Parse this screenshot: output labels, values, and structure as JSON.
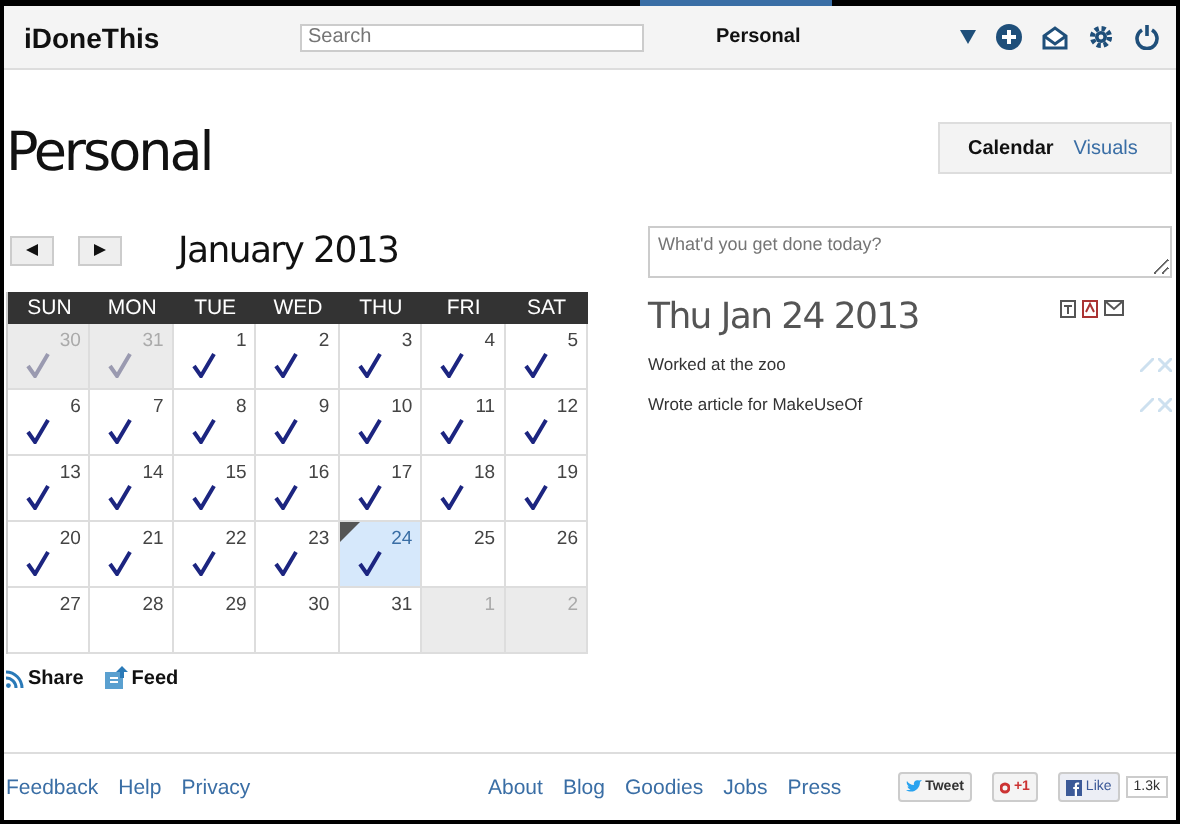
{
  "header": {
    "logo": "iDoneThis",
    "search": {
      "placeholder": "Search"
    },
    "team": "Personal"
  },
  "page_title": "Personal",
  "view_tabs": [
    {
      "label": "Calendar",
      "selected": true
    },
    {
      "label": "Visuals",
      "selected": false
    }
  ],
  "calendar": {
    "month": "January 2013",
    "weekdays": [
      "SUN",
      "MON",
      "TUE",
      "WED",
      "THU",
      "FRI",
      "SAT"
    ],
    "weeks": [
      [
        {
          "day": "30",
          "checked": true,
          "other_month": true,
          "selected": false
        },
        {
          "day": "31",
          "checked": true,
          "other_month": true,
          "selected": false
        },
        {
          "day": "1",
          "checked": true,
          "other_month": false,
          "selected": false
        },
        {
          "day": "2",
          "checked": true,
          "other_month": false,
          "selected": false
        },
        {
          "day": "3",
          "checked": true,
          "other_month": false,
          "selected": false
        },
        {
          "day": "4",
          "checked": true,
          "other_month": false,
          "selected": false
        },
        {
          "day": "5",
          "checked": true,
          "other_month": false,
          "selected": false
        }
      ],
      [
        {
          "day": "6",
          "checked": true,
          "other_month": false,
          "selected": false
        },
        {
          "day": "7",
          "checked": true,
          "other_month": false,
          "selected": false
        },
        {
          "day": "8",
          "checked": true,
          "other_month": false,
          "selected": false
        },
        {
          "day": "9",
          "checked": true,
          "other_month": false,
          "selected": false
        },
        {
          "day": "10",
          "checked": true,
          "other_month": false,
          "selected": false
        },
        {
          "day": "11",
          "checked": true,
          "other_month": false,
          "selected": false
        },
        {
          "day": "12",
          "checked": true,
          "other_month": false,
          "selected": false
        }
      ],
      [
        {
          "day": "13",
          "checked": true,
          "other_month": false,
          "selected": false
        },
        {
          "day": "14",
          "checked": true,
          "other_month": false,
          "selected": false
        },
        {
          "day": "15",
          "checked": true,
          "other_month": false,
          "selected": false
        },
        {
          "day": "16",
          "checked": true,
          "other_month": false,
          "selected": false
        },
        {
          "day": "17",
          "checked": true,
          "other_month": false,
          "selected": false
        },
        {
          "day": "18",
          "checked": true,
          "other_month": false,
          "selected": false
        },
        {
          "day": "19",
          "checked": true,
          "other_month": false,
          "selected": false
        }
      ],
      [
        {
          "day": "20",
          "checked": true,
          "other_month": false,
          "selected": false
        },
        {
          "day": "21",
          "checked": true,
          "other_month": false,
          "selected": false
        },
        {
          "day": "22",
          "checked": true,
          "other_month": false,
          "selected": false
        },
        {
          "day": "23",
          "checked": true,
          "other_month": false,
          "selected": false
        },
        {
          "day": "24",
          "checked": true,
          "other_month": false,
          "selected": true
        },
        {
          "day": "25",
          "checked": false,
          "other_month": false,
          "selected": false
        },
        {
          "day": "26",
          "checked": false,
          "other_month": false,
          "selected": false
        }
      ],
      [
        {
          "day": "27",
          "checked": false,
          "other_month": false,
          "selected": false
        },
        {
          "day": "28",
          "checked": false,
          "other_month": false,
          "selected": false
        },
        {
          "day": "29",
          "checked": false,
          "other_month": false,
          "selected": false
        },
        {
          "day": "30",
          "checked": false,
          "other_month": false,
          "selected": false
        },
        {
          "day": "31",
          "checked": false,
          "other_month": false,
          "selected": false
        },
        {
          "day": "1",
          "checked": false,
          "other_month": true,
          "selected": false
        },
        {
          "day": "2",
          "checked": false,
          "other_month": true,
          "selected": false
        }
      ]
    ]
  },
  "share_links": [
    "Share",
    "Feed"
  ],
  "entry": {
    "placeholder": "What'd you get done today?"
  },
  "day": {
    "title": "Thu Jan 24 2013",
    "items": [
      "Worked at the zoo",
      "Wrote article for MakeUseOf"
    ]
  },
  "footer": {
    "left_links": [
      "Feedback",
      "Help",
      "Privacy"
    ],
    "right_links": [
      "About",
      "Blog",
      "Goodies",
      "Jobs",
      "Press"
    ],
    "tweet": "Tweet",
    "plus_one": "+1",
    "like": "Like",
    "like_count": "1.3k"
  }
}
